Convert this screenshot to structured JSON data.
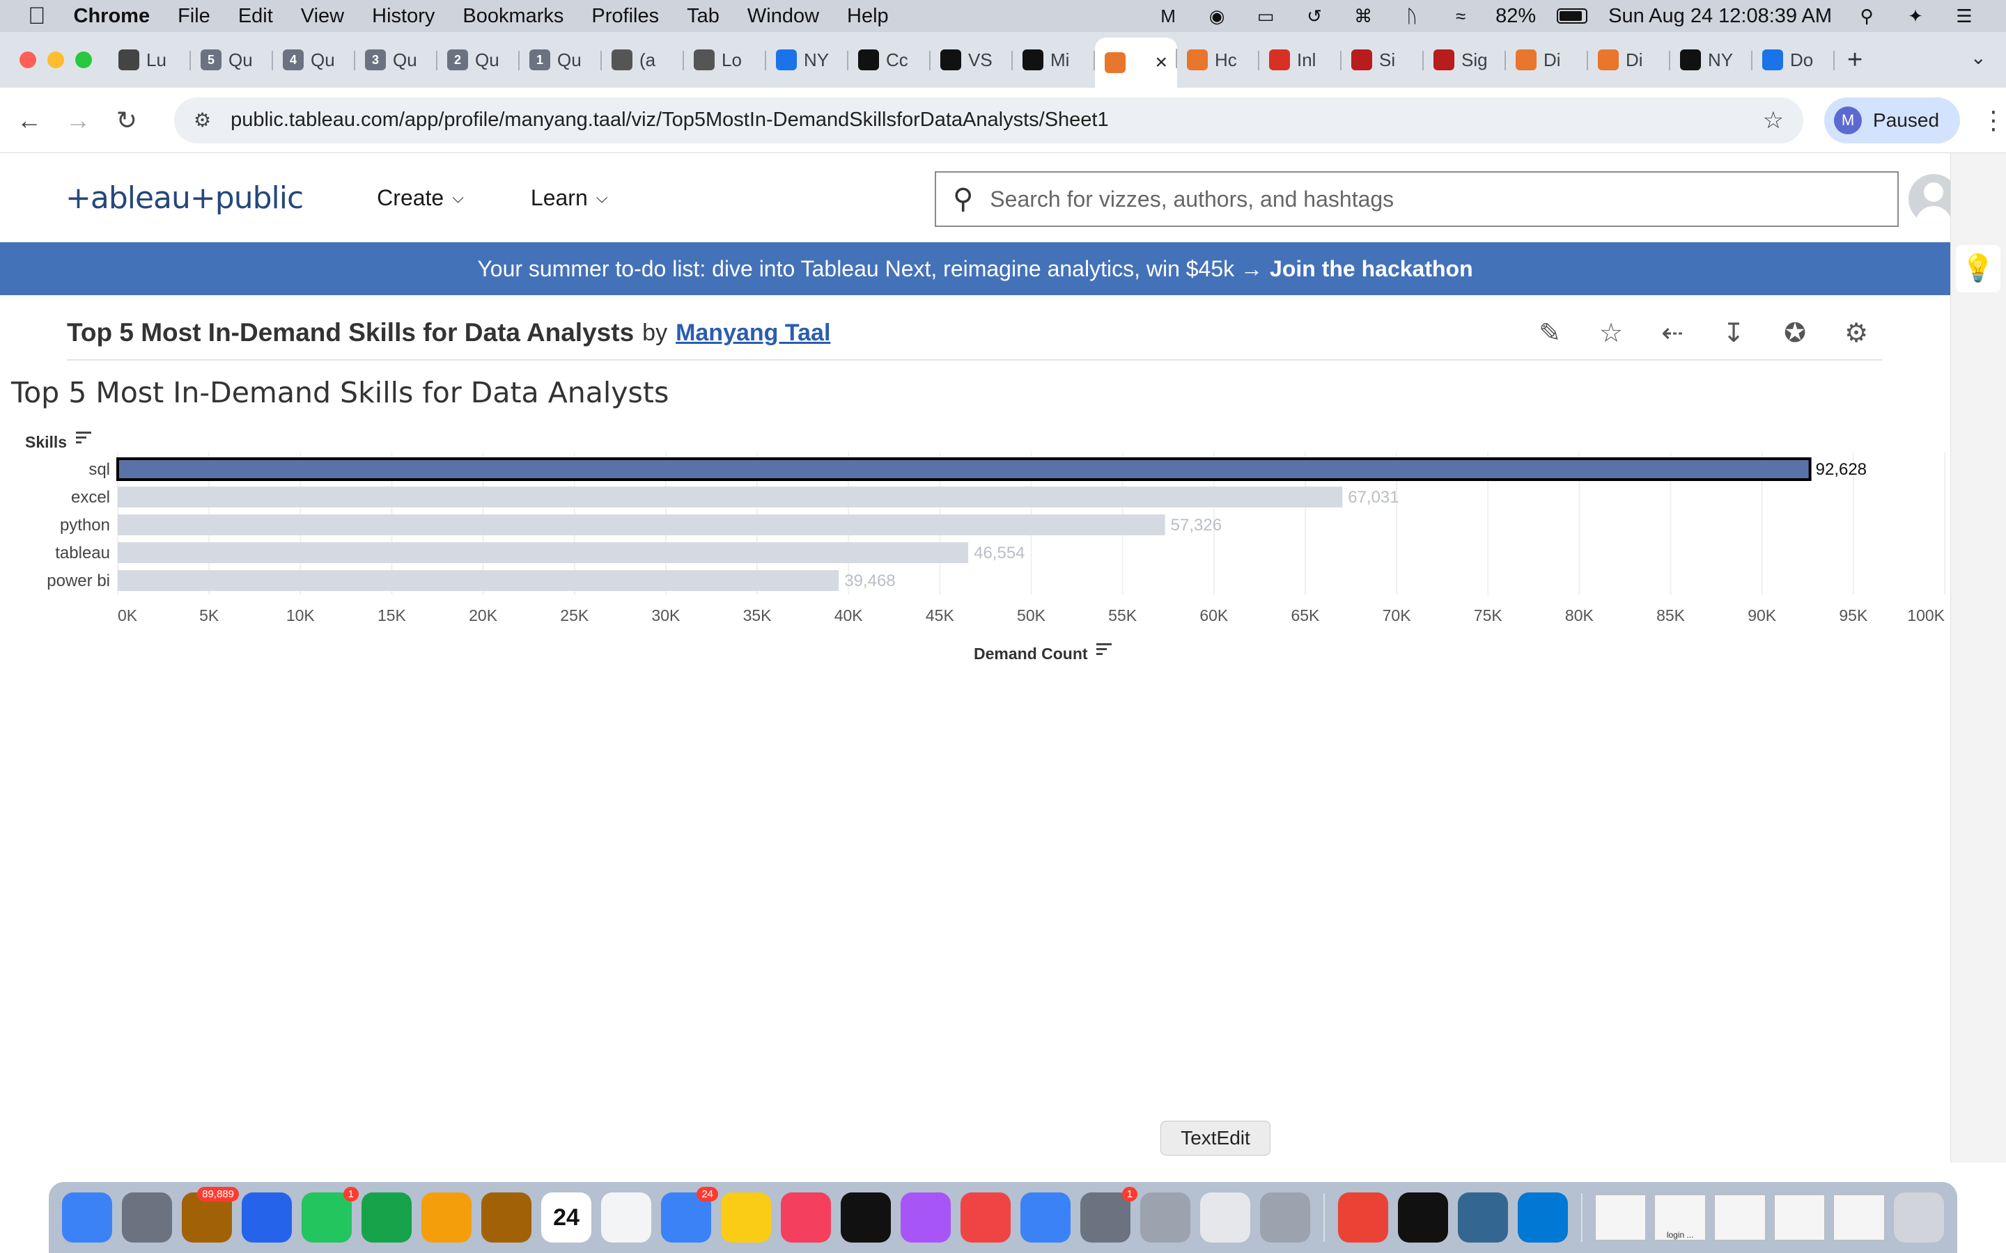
{
  "menubar": {
    "app_name": "Chrome",
    "items": [
      "File",
      "Edit",
      "View",
      "History",
      "Bookmarks",
      "Profiles",
      "Tab",
      "Window",
      "Help"
    ],
    "battery": "82%",
    "datetime": "Sun Aug 24  12:08:39 AM"
  },
  "tabs": [
    {
      "label": "Lu",
      "icon": "person-icon",
      "color": "#444"
    },
    {
      "label": "Qu",
      "icon": "5",
      "color": "#6b7280"
    },
    {
      "label": "Qu",
      "icon": "4",
      "color": "#6b7280"
    },
    {
      "label": "Qu",
      "icon": "3",
      "color": "#6b7280"
    },
    {
      "label": "Qu",
      "icon": "2",
      "color": "#6b7280"
    },
    {
      "label": "Qu",
      "icon": "1",
      "color": "#6b7280"
    },
    {
      "label": "(a",
      "icon": "globe-icon",
      "color": "#555"
    },
    {
      "label": "Lo",
      "icon": "doc-icon",
      "color": "#555"
    },
    {
      "label": "NY",
      "icon": "card-icon",
      "color": "#1a73e8"
    },
    {
      "label": "Cc",
      "icon": "github-icon",
      "color": "#111"
    },
    {
      "label": "VS",
      "icon": "openai-icon",
      "color": "#111"
    },
    {
      "label": "Mi",
      "icon": "github-icon",
      "color": "#111"
    },
    {
      "label": "",
      "icon": "tableau-icon",
      "color": "#e8762d",
      "active": true
    },
    {
      "label": "Hc",
      "icon": "tableau-icon",
      "color": "#e8762d"
    },
    {
      "label": "Inl",
      "icon": "gmail-icon",
      "color": "#d93025"
    },
    {
      "label": "Si",
      "icon": "stats-icon",
      "color": "#b91c1c"
    },
    {
      "label": "Sig",
      "icon": "stats-icon",
      "color": "#b91c1c"
    },
    {
      "label": "Di",
      "icon": "tableau-icon",
      "color": "#e8762d"
    },
    {
      "label": "Di",
      "icon": "tableau-icon",
      "color": "#e8762d"
    },
    {
      "label": "NY",
      "icon": "nyt-icon",
      "color": "#111"
    },
    {
      "label": "Do",
      "icon": "download-icon",
      "color": "#1a73e8"
    }
  ],
  "browser": {
    "url": "public.tableau.com/app/profile/manyang.taal/viz/Top5MostIn-DemandSkillsforDataAnalysts/Sheet1",
    "profile_initial": "M",
    "profile_status": "Paused"
  },
  "site": {
    "logo_text": "+ableau+public",
    "nav": [
      {
        "label": "Create"
      },
      {
        "label": "Learn"
      }
    ],
    "search_placeholder": "Search for vizzes, authors, and hashtags"
  },
  "banner": {
    "text": "Your summer to-do list: dive into Tableau Next, reimagine analytics, win $45k →",
    "link": "Join the hackathon"
  },
  "viz": {
    "title": "Top 5 Most In-Demand Skills for Data Analysts",
    "by": "by",
    "author": "Manyang Taal",
    "actions": [
      "edit-viz-icon",
      "favorite-star-icon",
      "share-icon",
      "download-icon",
      "badge-icon",
      "settings-gear-icon"
    ]
  },
  "chart_data": {
    "type": "bar",
    "orientation": "horizontal",
    "title": "Top 5 Most In-Demand Skills for Data Analysts",
    "ylabel": "Skills",
    "xlabel": "Demand Count",
    "categories": [
      "sql",
      "excel",
      "python",
      "tableau",
      "power bi"
    ],
    "values": [
      92628,
      67031,
      57326,
      46554,
      39468
    ],
    "value_labels": [
      "92,628",
      "67,031",
      "57,326",
      "46,554",
      "39,468"
    ],
    "xlim": [
      0,
      100000
    ],
    "xticks": [
      "0K",
      "5K",
      "10K",
      "15K",
      "20K",
      "25K",
      "30K",
      "35K",
      "40K",
      "45K",
      "50K",
      "55K",
      "60K",
      "65K",
      "70K",
      "75K",
      "80K",
      "85K",
      "90K",
      "95K",
      "100K"
    ],
    "highlighted": "sql",
    "colors": {
      "highlight": "#5b72a8",
      "dim": "#d5dae2",
      "label_dim": "#b9bec6",
      "label_highlight": "#111111"
    },
    "grid": true
  },
  "dock": {
    "tooltip": "TextEdit",
    "apps": [
      {
        "name": "finder-icon",
        "color": "#3b82f6"
      },
      {
        "name": "launchpad-icon",
        "color": "#6b7280"
      },
      {
        "name": "mail-stamp-icon",
        "color": "#a16207",
        "badge": "89,889"
      },
      {
        "name": "safari-icon",
        "color": "#2563eb"
      },
      {
        "name": "facetime-icon",
        "color": "#22c55e",
        "badge": "1"
      },
      {
        "name": "maps-icon",
        "color": "#16a34a"
      },
      {
        "name": "photos-icon",
        "color": "#f59e0b"
      },
      {
        "name": "contacts-icon",
        "color": "#a16207"
      },
      {
        "name": "calendar-icon",
        "color": "#ffffff",
        "text": "24"
      },
      {
        "name": "reminders-icon",
        "color": "#f3f4f6"
      },
      {
        "name": "messages-icon",
        "color": "#3b82f6",
        "badge": "24"
      },
      {
        "name": "notes-icon",
        "color": "#facc15"
      },
      {
        "name": "music-icon",
        "color": "#f43f5e"
      },
      {
        "name": "tv-icon",
        "color": "#111111"
      },
      {
        "name": "podcasts-icon",
        "color": "#a855f7"
      },
      {
        "name": "news-icon",
        "color": "#ef4444"
      },
      {
        "name": "appstore-icon",
        "color": "#3b82f6"
      },
      {
        "name": "system-settings-icon",
        "color": "#6b7280",
        "badge": "1"
      },
      {
        "name": "help-icon",
        "color": "#9ca3af"
      },
      {
        "name": "textedit-icon",
        "color": "#e5e7eb"
      },
      {
        "name": "help-icon",
        "color": "#9ca3af"
      },
      {
        "name": "chrome-icon",
        "color": "#ea4335"
      },
      {
        "name": "terminal-icon",
        "color": "#111111"
      },
      {
        "name": "postgres-icon",
        "color": "#336791"
      },
      {
        "name": "vscode-icon",
        "color": "#0078d4"
      }
    ],
    "thumb_label": "login ..."
  }
}
